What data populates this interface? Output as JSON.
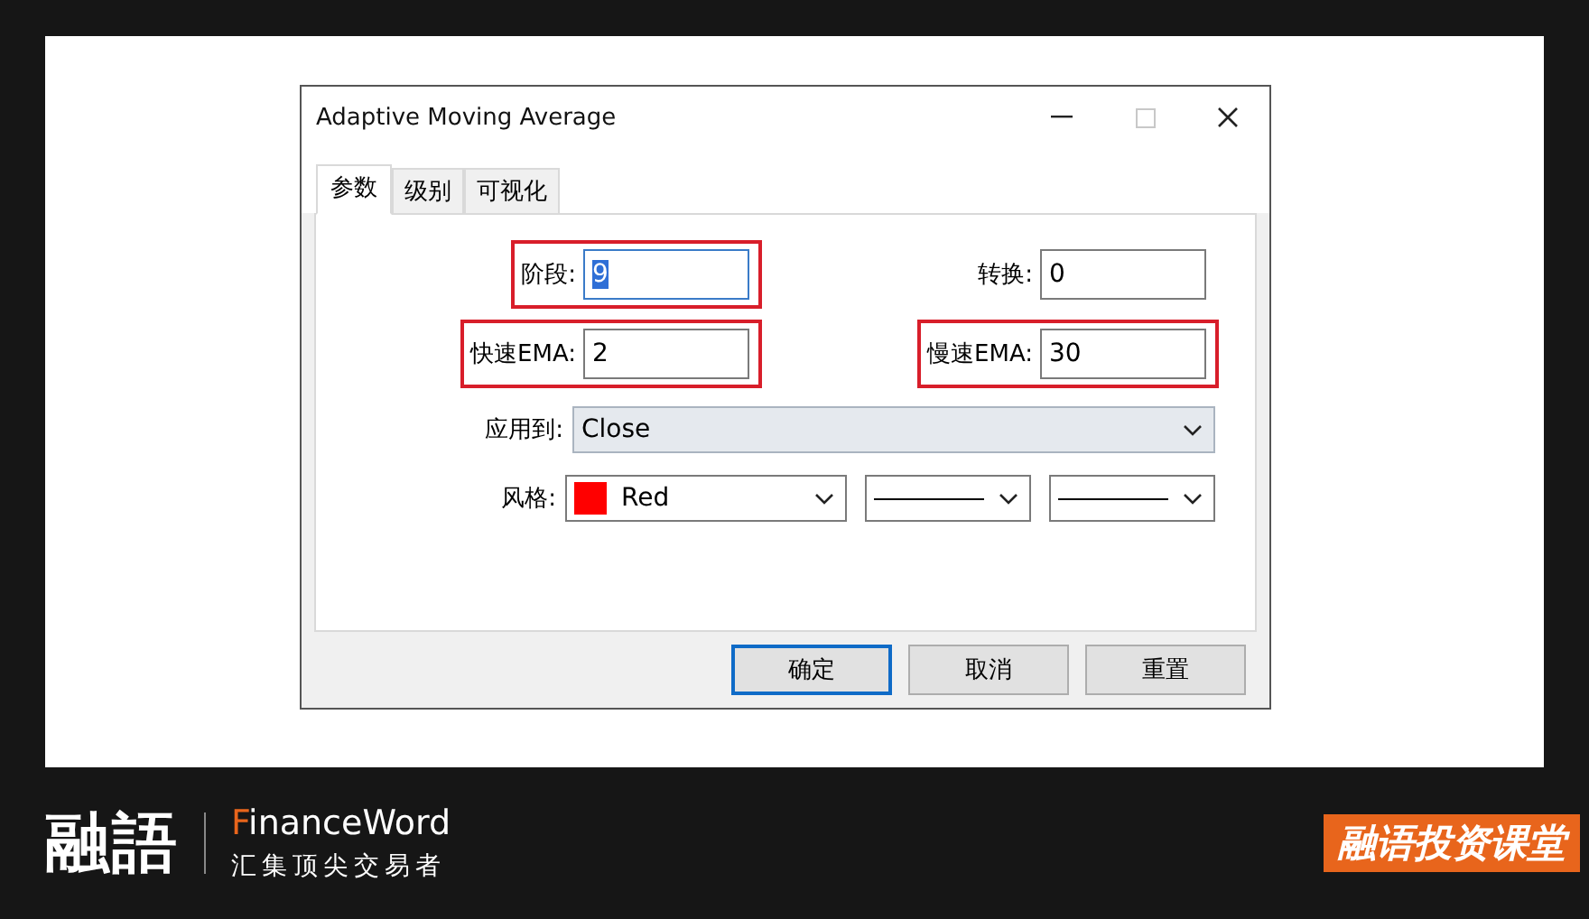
{
  "window": {
    "title": "Adaptive Moving Average",
    "maximize_disabled": true
  },
  "tabs": [
    {
      "label": "参数",
      "selected": true
    },
    {
      "label": "级别",
      "selected": false
    },
    {
      "label": "可视化",
      "selected": false
    }
  ],
  "parameters": [
    {
      "label": "阶段:",
      "value": "9",
      "highlighted": true,
      "selected": true
    },
    {
      "label": "转换:",
      "value": "0",
      "highlighted": false,
      "selected": false
    },
    {
      "label": "快速EMA:",
      "value": "2",
      "highlighted": true,
      "selected": false
    },
    {
      "label": "慢速EMA:",
      "value": "30",
      "highlighted": true,
      "selected": false
    }
  ],
  "apply_to": {
    "label": "应用到:",
    "value": "Close"
  },
  "style": {
    "label": "风格:",
    "color_name": "Red",
    "color": "#ff0000"
  },
  "buttons": [
    {
      "label": "确定",
      "default": true
    },
    {
      "label": "取消",
      "default": false
    },
    {
      "label": "重置",
      "default": false
    }
  ],
  "brand": {
    "logo": "融語",
    "name": "FinanceWord",
    "slogan": "汇集顶尖交易者",
    "badge": "融语投资课堂"
  }
}
